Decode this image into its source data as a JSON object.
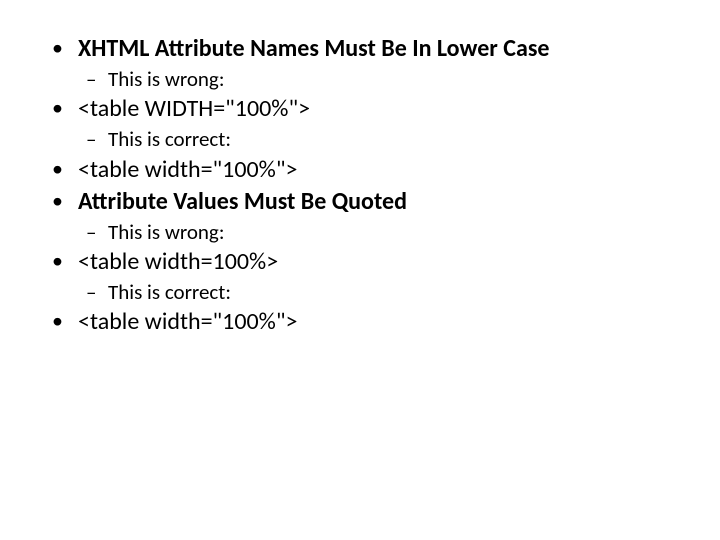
{
  "slide": {
    "b1": "XHTML Attribute Names Must Be In Lower Case",
    "b1_sub": "This is wrong:",
    "b2": "<table WIDTH=\"100%\">",
    "b2_sub": "This is correct:",
    "b3": "<table width=\"100%\">",
    "b4": "Attribute Values Must Be Quoted",
    "b4_sub": "This is wrong:",
    "b5": "<table width=100%>",
    "b5_sub": "This is correct:",
    "b6": "<table width=\"100%\">"
  }
}
